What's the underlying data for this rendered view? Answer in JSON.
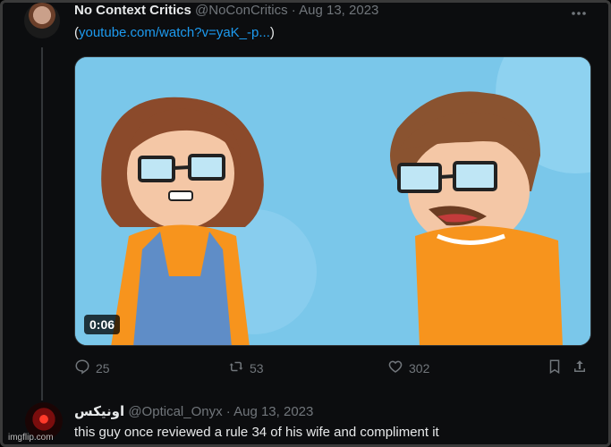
{
  "tweet": {
    "author_name": "No Context Critics",
    "handle": "@NoConCritics",
    "separator": "·",
    "date": "Aug 13, 2023",
    "text_open": "(",
    "link_text": "youtube.com/watch?v=yaK_-p...",
    "text_close": ")",
    "more_icon": "more-horizontal-icon",
    "media": {
      "duration": "0:06"
    },
    "actions": {
      "replies": "25",
      "retweets": "53",
      "likes": "302"
    }
  },
  "reply": {
    "author_name": "اونيكس",
    "handle": "@Optical_Onyx",
    "separator": "·",
    "date": "Aug 13, 2023",
    "text": "this guy once reviewed a rule 34 of his wife and compliment it"
  },
  "watermark": "imgflip.com",
  "colors": {
    "background": "#0c0d0f",
    "text": "#e7e9ea",
    "muted": "#71767b",
    "link": "#1d9bf0",
    "sky": "#7ac7ea"
  }
}
